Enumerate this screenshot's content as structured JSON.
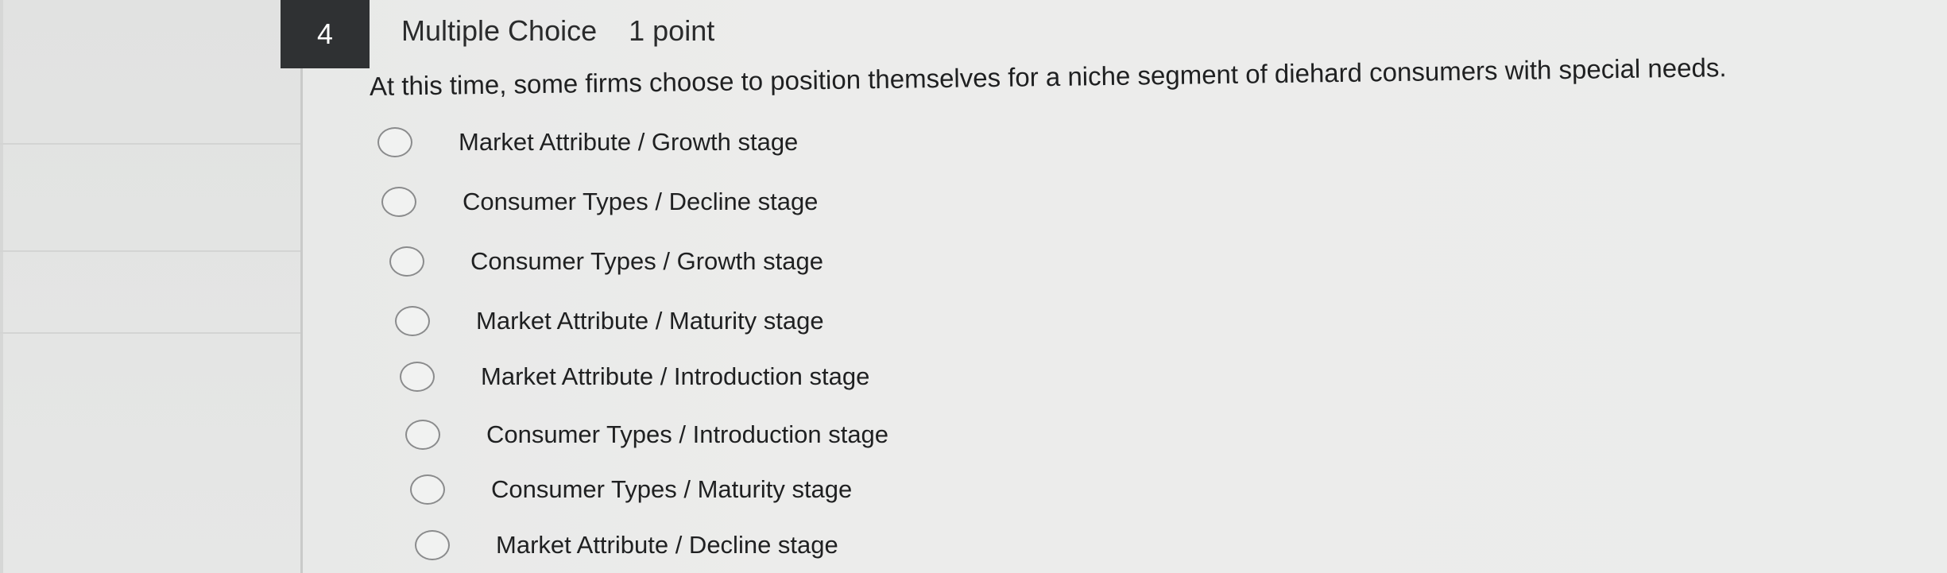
{
  "question": {
    "number": "4",
    "type": "Multiple Choice",
    "points": "1 point",
    "stem": "At this time, some firms choose to position themselves for a niche segment of diehard consumers with special needs."
  },
  "options": [
    {
      "label": "Market Attribute / Growth stage"
    },
    {
      "label": "Consumer Types / Decline stage"
    },
    {
      "label": "Consumer Types / Growth stage"
    },
    {
      "label": "Market Attribute / Maturity stage"
    },
    {
      "label": "Market Attribute / Introduction stage"
    },
    {
      "label": "Consumer Types / Introduction stage"
    },
    {
      "label": "Consumer Types / Maturity stage"
    },
    {
      "label": "Market Attribute / Decline stage"
    }
  ]
}
